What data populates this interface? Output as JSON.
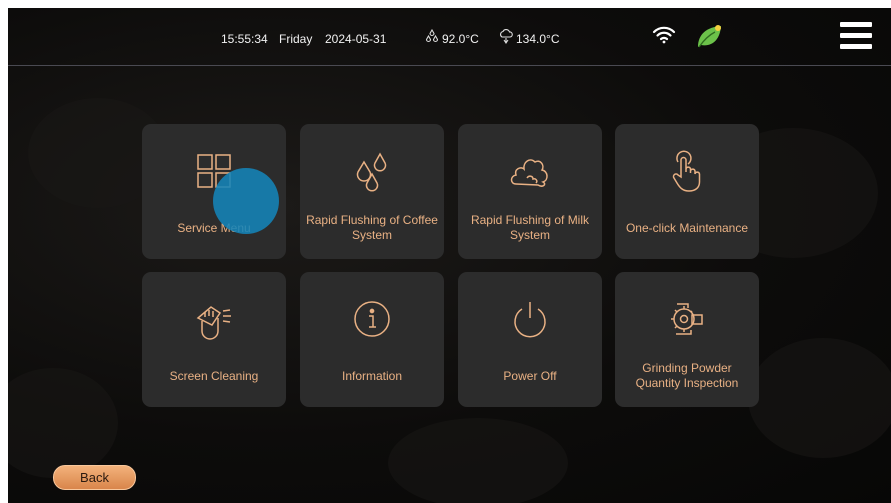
{
  "status_bar": {
    "time": "15:55:34",
    "day": "Friday",
    "date": "2024-05-31",
    "temp1": "92.0°C",
    "temp2": "134.0°C",
    "icons": [
      "water-drops-icon",
      "steam-icon",
      "wifi-icon",
      "leaf-icon",
      "hamburger-menu-icon"
    ]
  },
  "tiles": [
    {
      "label": "Service Menu",
      "icon": "grid-icon"
    },
    {
      "label": "Rapid Flushing of Coffee System",
      "icon": "coffee-drops-icon"
    },
    {
      "label": "Rapid Flushing of Milk System",
      "icon": "milk-foam-icon"
    },
    {
      "label": "One-click Maintenance",
      "icon": "touch-finger-icon"
    },
    {
      "label": "Screen Cleaning",
      "icon": "cleaning-hand-icon"
    },
    {
      "label": "Information",
      "icon": "info-icon"
    },
    {
      "label": "Power Off",
      "icon": "power-icon"
    },
    {
      "label": "Grinding Powder Quantity Inspection",
      "icon": "grinder-icon"
    }
  ],
  "back_label": "Back",
  "colors": {
    "accent": "#e9b184",
    "tile_bg": "#2c2c2c",
    "touch_indicator": "#1484b8",
    "leaf": "#6cc24a",
    "back_button": "#e59a5f"
  }
}
